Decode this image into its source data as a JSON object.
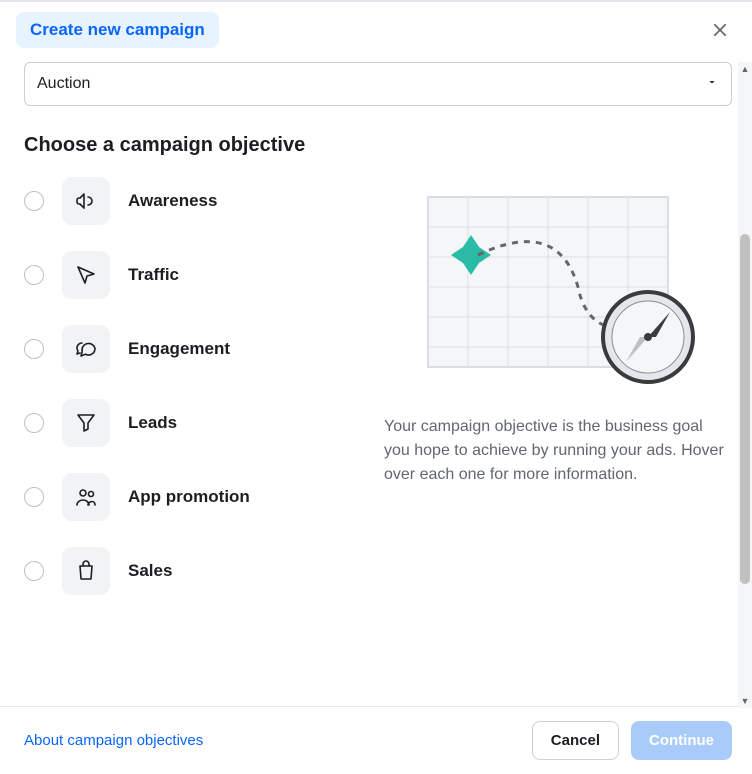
{
  "header": {
    "title": "Create new campaign"
  },
  "buying_type": {
    "selected": "Auction"
  },
  "objective": {
    "section_title": "Choose a campaign objective",
    "options": [
      {
        "label": "Awareness"
      },
      {
        "label": "Traffic"
      },
      {
        "label": "Engagement"
      },
      {
        "label": "Leads"
      },
      {
        "label": "App promotion"
      },
      {
        "label": "Sales"
      }
    ],
    "info_text": "Your campaign objective is the business goal you hope to achieve by running your ads. Hover over each one for more information."
  },
  "footer": {
    "link_label": "About campaign objectives",
    "cancel_label": "Cancel",
    "continue_label": "Continue"
  }
}
